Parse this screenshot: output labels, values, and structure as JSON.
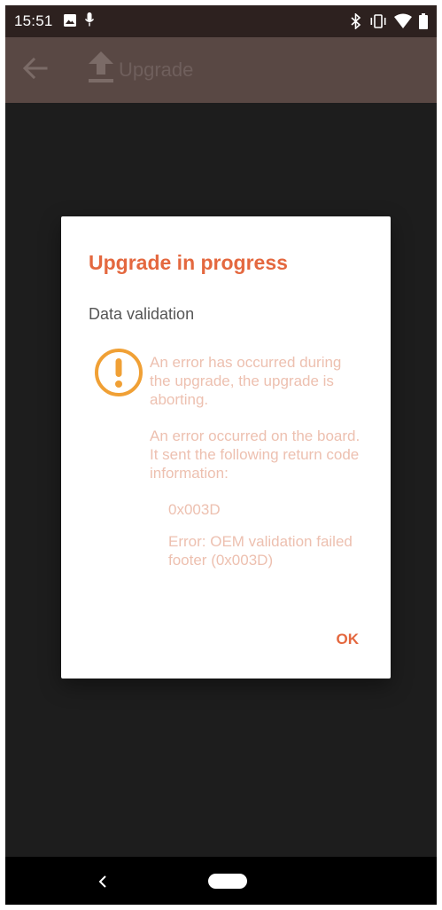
{
  "status_bar": {
    "time": "15:51",
    "icons": [
      "image-icon",
      "mic-icon",
      "bluetooth-icon",
      "vibrate-icon",
      "wifi-icon",
      "battery-icon"
    ]
  },
  "app_bar": {
    "title": "Upgrade",
    "icons": [
      "back-arrow-icon",
      "upload-icon"
    ]
  },
  "dialog": {
    "title": "Upgrade in progress",
    "subtitle": "Data validation",
    "icon": "warning-icon",
    "message_1": "An error has occurred during the upgrade, the upgrade is aborting.",
    "message_2": "An error occurred on the board. It sent the following return code information:",
    "return_code": "0x003D",
    "error_detail": "Error: OEM validation failed footer (0x003D)",
    "ok_label": "OK"
  },
  "nav_bar": {
    "icons": [
      "nav-back-icon",
      "nav-home-icon"
    ]
  },
  "colors": {
    "accent": "#e4683f",
    "dim_text": "#edc0b0",
    "app_bar": "#594844",
    "status_bar": "#2d211f",
    "warning": "#f0a035"
  }
}
